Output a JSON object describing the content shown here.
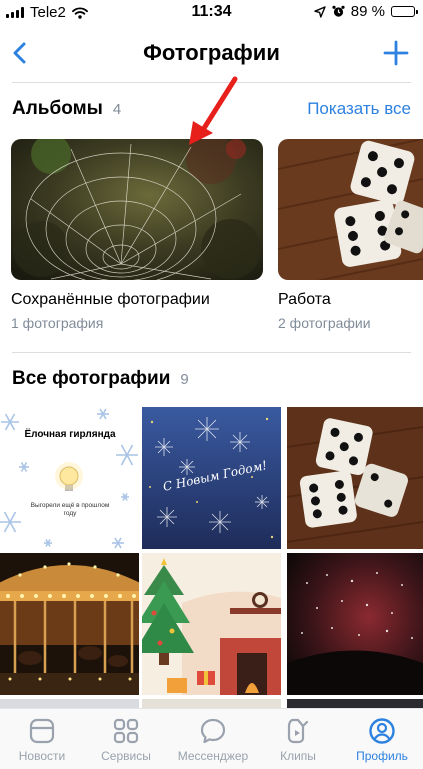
{
  "status_bar": {
    "carrier": "Tele2",
    "time": "11:34",
    "battery": "89 %",
    "battery_level": 0.89
  },
  "nav": {
    "title": "Фотографии"
  },
  "albums": {
    "title": "Альбомы",
    "count": "4",
    "show_all": "Показать все",
    "items": [
      {
        "name": "Сохранённые фотографии",
        "count": "1 фотография"
      },
      {
        "name": "Работа",
        "count": "2 фотографии"
      }
    ]
  },
  "all_photos": {
    "title": "Все фотографии",
    "count": "9",
    "garland_card": {
      "title": "Ёлочная гирлянда",
      "caption": "Выгорели ещё в прошлом году"
    },
    "newyear_text": "С Новым Годом!"
  },
  "tabbar": {
    "items": [
      {
        "label": "Новости",
        "icon": "news-icon"
      },
      {
        "label": "Сервисы",
        "icon": "services-icon"
      },
      {
        "label": "Мессенджер",
        "icon": "messenger-icon"
      },
      {
        "label": "Клипы",
        "icon": "clips-icon"
      },
      {
        "label": "Профиль",
        "icon": "profile-icon"
      }
    ],
    "active": "Профиль"
  },
  "colors": {
    "accent": "#2d81e0",
    "secondary_text": "#818c99",
    "annotation_arrow": "#e8201c"
  }
}
